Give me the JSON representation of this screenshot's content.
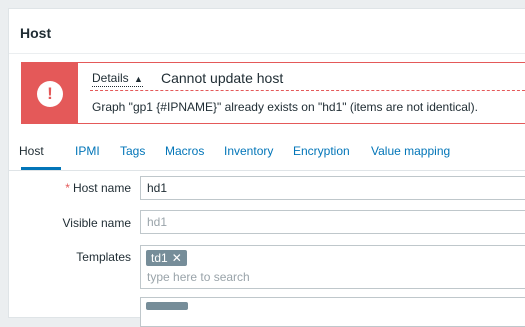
{
  "window": {
    "title": "Host"
  },
  "alert": {
    "details_label": "Details",
    "details_arrow": "▲",
    "title": "Cannot update host",
    "message": "Graph \"gp1 {#IPNAME}\" already exists on \"hd1\" (items are not identical).",
    "color": "#e45959"
  },
  "tabs": [
    {
      "label": "Host",
      "active": true
    },
    {
      "label": "IPMI",
      "active": false
    },
    {
      "label": "Tags",
      "active": false
    },
    {
      "label": "Macros",
      "active": false
    },
    {
      "label": "Inventory",
      "active": false
    },
    {
      "label": "Encryption",
      "active": false
    },
    {
      "label": "Value mapping",
      "active": false
    }
  ],
  "form": {
    "host_name": {
      "label": "Host name",
      "value": "hd1",
      "required_mark": "*"
    },
    "visible_name": {
      "label": "Visible name",
      "placeholder": "hd1"
    },
    "templates": {
      "label": "Templates",
      "chip": "td1",
      "chip_remove": "✕",
      "search_placeholder": "type here to search"
    }
  },
  "colors": {
    "accent": "#0275b8",
    "error": "#e45959",
    "chip": "#768d99"
  }
}
